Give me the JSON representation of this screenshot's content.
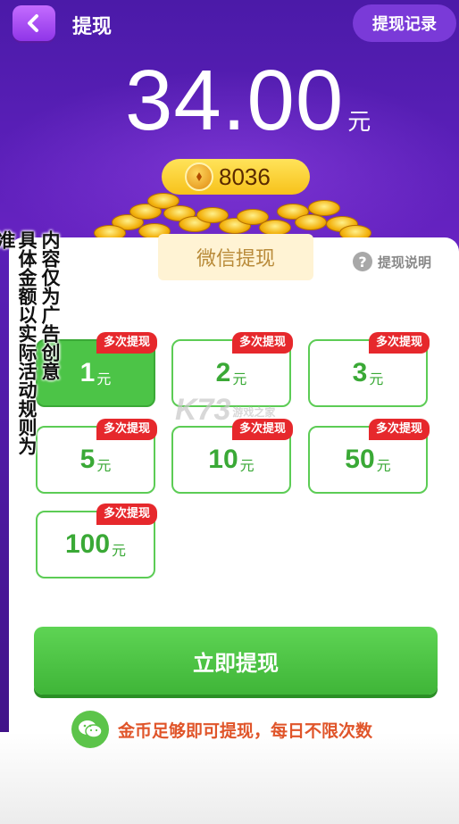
{
  "header": {
    "title": "提现",
    "records_label": "提现记录"
  },
  "balance": {
    "amount": "34.00",
    "unit": "元",
    "coins": "8036"
  },
  "tab": {
    "label": "微信提现"
  },
  "help": {
    "icon": "?",
    "label": "提现说明"
  },
  "disclaimer": {
    "col1": "内容仅为广告创意",
    "col2": "具体金额以实际活动规则为准"
  },
  "options": [
    {
      "value": "1",
      "unit": "元",
      "badge": "多次提现",
      "selected": true
    },
    {
      "value": "2",
      "unit": "元",
      "badge": "多次提现",
      "selected": false
    },
    {
      "value": "3",
      "unit": "元",
      "badge": "多次提现",
      "selected": false
    },
    {
      "value": "5",
      "unit": "元",
      "badge": "多次提现",
      "selected": false
    },
    {
      "value": "10",
      "unit": "元",
      "badge": "多次提现",
      "selected": false
    },
    {
      "value": "50",
      "unit": "元",
      "badge": "多次提现",
      "selected": false
    },
    {
      "value": "100",
      "unit": "元",
      "badge": "多次提现",
      "selected": false
    }
  ],
  "watermark": {
    "main": "K73",
    "sub": "游戏之家"
  },
  "cta": {
    "label": "立即提现"
  },
  "note": {
    "text": "金币足够即可提现，每日不限次数"
  },
  "colors": {
    "primary_purple": "#5a1fb8",
    "green": "#4cc447",
    "badge_red": "#e6282c",
    "gold": "#f7c21a",
    "note_orange": "#e0552a"
  }
}
